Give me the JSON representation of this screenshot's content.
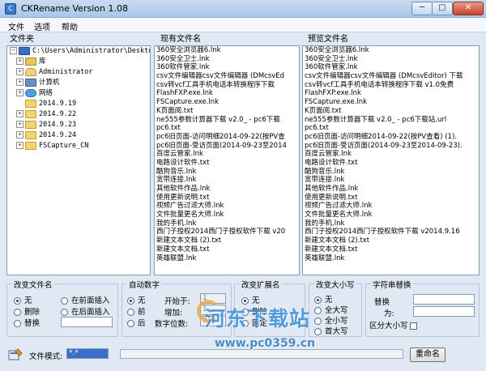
{
  "window": {
    "title": "CKRename Version 1.08",
    "icon": "app-icon",
    "min_label": "─",
    "max_label": "□",
    "close_label": "✕"
  },
  "menu": [
    "文件",
    "选项",
    "帮助"
  ],
  "folder_panel": {
    "header": "文件夹",
    "tree": [
      {
        "label": "C:\\Users\\Administrator\\Desktop",
        "icon": "desktop-icon",
        "expander": "−",
        "indent": 0
      },
      {
        "label": "库",
        "icon": "library-icon",
        "expander": "+",
        "indent": 1
      },
      {
        "label": "Administrator",
        "icon": "user-folder-icon",
        "expander": "+",
        "indent": 1
      },
      {
        "label": "计算机",
        "icon": "computer-icon",
        "expander": "+",
        "indent": 1
      },
      {
        "label": "网络",
        "icon": "network-icon",
        "expander": "+",
        "indent": 1
      },
      {
        "label": "2014.9.19",
        "icon": "folder-icon",
        "expander": "",
        "indent": 1
      },
      {
        "label": "2014.9.22",
        "icon": "folder-icon",
        "expander": "+",
        "indent": 1
      },
      {
        "label": "2014.9.23",
        "icon": "folder-icon",
        "expander": "+",
        "indent": 1
      },
      {
        "label": "2014.9.24",
        "icon": "folder-icon",
        "expander": "+",
        "indent": 1
      },
      {
        "label": "FSCapture_CN",
        "icon": "folder-icon",
        "expander": "+",
        "indent": 1
      }
    ]
  },
  "current_files": {
    "header": "现有文件名",
    "items": [
      "360安全浏览器6.lnk",
      "360安全卫士.lnk",
      "360软件管家.lnk",
      "csv文件编辑器csv文件编辑器 (DMcsvEd",
      "csv转vcf工具手机电话本转换程序下载",
      "FlashFXP.exe.lnk",
      "FSCapture.exe.lnk",
      "K页面阅.txt",
      "ne555参数计算器下载 v2.0_ - pc6下载",
      "pc6.txt",
      "pc6旧页面-访问明细2014-09-22(按PV查",
      "pc6旧页面-受访页面(2014-09-23至2014",
      "百度云管家.lnk",
      "电路设计软件.txt",
      "酷狗音乐.lnk",
      "宽带连接.lnk",
      "其他软件作品.lnk",
      "使用更新说明.txt",
      "视频广告过滤大师.lnk",
      "文件批量更名大师.lnk",
      "我的手机.lnk",
      "西门子授权2014西门子授权软件下载 v20",
      "新建文本文档 (2).txt",
      "新建文本文档.txt",
      "英雄联盟.lnk"
    ]
  },
  "preview_files": {
    "header": "预览文件名",
    "items": [
      "360安全浏览器6.lnk",
      "360安全卫士.lnk",
      "360软件管家.lnk",
      "csv文件编辑器csv文件编辑器 (DMcsvEditor) 下载",
      "csv转vcf工具手机电话本转换程序下载 v1.0免费",
      "FlashFXP.exe.lnk",
      "FSCapture.exe.lnk",
      "K页面阅.txt",
      "ne555参数计算器下载 v2.0_ - pc6下载站.url",
      "pc6.txt",
      "pc6旧页面-访问明细2014-09-22(按PV查看) (1).",
      "pc6旧页面-受访页面(2014-09-23至2014-09-23).",
      "百度云管家.lnk",
      "电路设计软件.txt",
      "酷狗音乐.lnk",
      "宽带连接.lnk",
      "其他软件作品.lnk",
      "使用更新说明.txt",
      "视频广告过滤大师.lnk",
      "文件批量更名大师.lnk",
      "我的手机.lnk",
      "西门子授权2014西门子授权软件下载 v2014.9.16",
      "新建文本文档 (2).txt",
      "新建文本文档.txt",
      "英雄联盟.lnk"
    ]
  },
  "groups": {
    "change_filename": {
      "title": "改变文件名",
      "opt_none": "无",
      "opt_delete": "删除",
      "opt_replace": "替换",
      "opt_insert_front": "在前面插入",
      "opt_insert_back": "在后面插入",
      "selected": "none"
    },
    "auto_number": {
      "title": "自动数字",
      "opt_none": "无",
      "opt_front": "前",
      "opt_back": "后",
      "start_label": "开始于:",
      "start_value": "1",
      "step_label": "增加:",
      "step_value": "1",
      "digits_label": "数字位数:",
      "digits_value": "3",
      "selected": "none"
    },
    "change_ext": {
      "title": "改变扩展名",
      "opt_none": "无",
      "opt_delete": "删除",
      "opt_fixed": "固定",
      "selected": "none"
    },
    "change_case": {
      "title": "改变大小写",
      "opt_none": "无",
      "opt_all_upper": "全大写",
      "opt_all_lower": "全小写",
      "opt_first_upper": "首大写",
      "selected": "none"
    },
    "string_replace": {
      "title": "字符串替换",
      "replace_label": "替换",
      "as_label": "为:",
      "case_label": "区分大小写"
    }
  },
  "bottom": {
    "pattern_label": "文件模式:",
    "pattern_value": "*.*",
    "rename_label": "重命名",
    "progress_percent": 0
  },
  "watermark": {
    "main": "河东下载站",
    "url": "www.pc0359.cn"
  }
}
